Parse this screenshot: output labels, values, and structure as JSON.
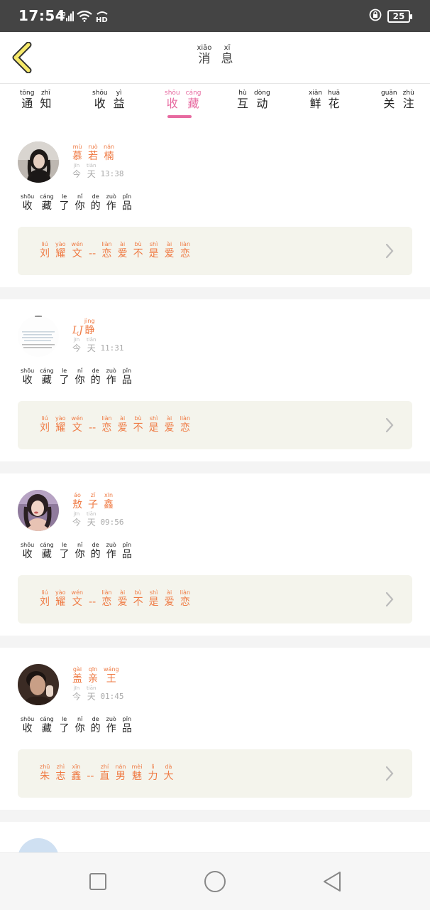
{
  "status": {
    "time": "17:54",
    "network": "4G",
    "hd": "HD",
    "battery": "25"
  },
  "header": {
    "title_py": [
      "xiāo",
      "xī"
    ],
    "title_zh": [
      "消",
      "息"
    ]
  },
  "tabs": [
    {
      "py": [
        "tōng",
        "zhī"
      ],
      "zh": [
        "通",
        "知"
      ]
    },
    {
      "py": [
        "shōu",
        "yì"
      ],
      "zh": [
        "收",
        "益"
      ]
    },
    {
      "py": [
        "shōu",
        "cáng"
      ],
      "zh": [
        "收",
        "藏"
      ]
    },
    {
      "py": [
        "hù",
        "dòng"
      ],
      "zh": [
        "互",
        "动"
      ]
    },
    {
      "py": [
        "xiān",
        "huā"
      ],
      "zh": [
        "鲜",
        "花"
      ]
    },
    {
      "py": [
        "guān",
        "zhù"
      ],
      "zh": [
        "关",
        "注"
      ]
    }
  ],
  "active_tab": 2,
  "colors": {
    "accent": "#e76aa0",
    "name": "#ef7a43",
    "box_bg": "#f4f4ec"
  },
  "items": [
    {
      "name_py": [
        "mù",
        "ruò",
        "nán"
      ],
      "name_zh": [
        "慕",
        "若",
        "楠"
      ],
      "time_py": [
        "jīn",
        "tiān"
      ],
      "time_zh": [
        "今",
        "天"
      ],
      "time": "13:38",
      "action_py": [
        "shōu",
        "cáng",
        "le",
        "nǐ",
        "de",
        "zuò",
        "pǐn"
      ],
      "action_zh": [
        "收",
        "藏",
        "了",
        "你",
        "的",
        "作",
        "品"
      ],
      "work_py": [
        "liú",
        "yào",
        "wén",
        "",
        "liàn",
        "ài",
        "bù",
        "shì",
        "ài",
        "liàn"
      ],
      "work_zh": [
        "刘",
        "耀",
        "文",
        "--",
        "恋",
        "爱",
        "不",
        "是",
        "爱",
        "恋"
      ],
      "avatar": "avatar-girl-dark-hair"
    },
    {
      "name_py": [
        "",
        "jìng"
      ],
      "name_zh": [
        "LJ",
        "静"
      ],
      "time_py": [
        "jīn",
        "tiān"
      ],
      "time_zh": [
        "今",
        "天"
      ],
      "time": "11:31",
      "action_py": [
        "shōu",
        "cáng",
        "le",
        "nǐ",
        "de",
        "zuò",
        "pǐn"
      ],
      "action_zh": [
        "收",
        "藏",
        "了",
        "你",
        "的",
        "作",
        "品"
      ],
      "work_py": [
        "liú",
        "yào",
        "wén",
        "",
        "liàn",
        "ài",
        "bù",
        "shì",
        "ài",
        "liàn"
      ],
      "work_zh": [
        "刘",
        "耀",
        "文",
        "--",
        "恋",
        "爱",
        "不",
        "是",
        "爱",
        "恋"
      ],
      "avatar": "avatar-text-image"
    },
    {
      "name_py": [
        "áo",
        "zǐ",
        "xīn"
      ],
      "name_zh": [
        "敖",
        "子",
        "鑫"
      ],
      "time_py": [
        "jīn",
        "tiān"
      ],
      "time_zh": [
        "今",
        "天"
      ],
      "time": "09:56",
      "action_py": [
        "shōu",
        "cáng",
        "le",
        "nǐ",
        "de",
        "zuò",
        "pǐn"
      ],
      "action_zh": [
        "收",
        "藏",
        "了",
        "你",
        "的",
        "作",
        "品"
      ],
      "work_py": [
        "liú",
        "yào",
        "wén",
        "",
        "liàn",
        "ài",
        "bù",
        "shì",
        "ài",
        "liàn"
      ],
      "work_zh": [
        "刘",
        "耀",
        "文",
        "--",
        "恋",
        "爱",
        "不",
        "是",
        "爱",
        "恋"
      ],
      "avatar": "avatar-girl-purple"
    },
    {
      "name_py": [
        "gài",
        "qīn",
        "wáng"
      ],
      "name_zh": [
        "盖",
        "亲",
        "王"
      ],
      "time_py": [
        "jīn",
        "tiān"
      ],
      "time_zh": [
        "今",
        "天"
      ],
      "time": "01:45",
      "action_py": [
        "shōu",
        "cáng",
        "le",
        "nǐ",
        "de",
        "zuò",
        "pǐn"
      ],
      "action_zh": [
        "收",
        "藏",
        "了",
        "你",
        "的",
        "作",
        "品"
      ],
      "work_py": [
        "zhū",
        "zhì",
        "xīn",
        "",
        "zhí",
        "nán",
        "mèi",
        "lì",
        "dà"
      ],
      "work_zh": [
        "朱",
        "志",
        "鑫",
        "--",
        "直",
        "男",
        "魅",
        "力",
        "大"
      ],
      "avatar": "avatar-man-dark"
    }
  ],
  "nav": {
    "recent": "square-nav-icon",
    "home": "circle-nav-icon",
    "back": "triangle-back-nav-icon"
  }
}
